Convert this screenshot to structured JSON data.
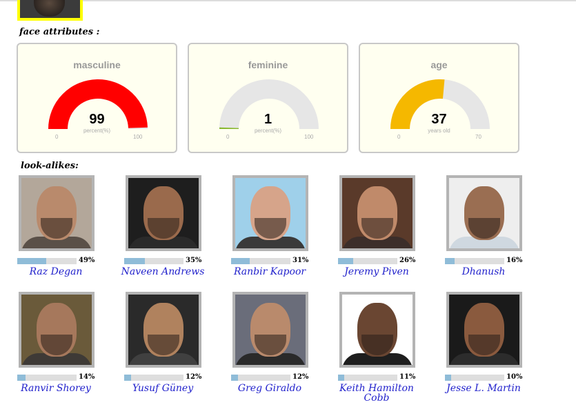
{
  "face_attributes_title": "face attributes :",
  "look_alikes_title": "look-alikes:",
  "gauges": [
    {
      "title": "masculine",
      "value": 99,
      "display": "99",
      "unit": "percent(%)",
      "min": "0",
      "max": "100",
      "color": "#ff0000"
    },
    {
      "title": "feminine",
      "value": 1,
      "display": "1",
      "unit": "percent(%)",
      "min": "0",
      "max": "100",
      "color": "#88b830"
    },
    {
      "title": "age",
      "value": 37,
      "display": "37",
      "unit": "years old",
      "min": "0",
      "max": "70",
      "color": "#f5b800"
    }
  ],
  "gauge_track_color": "#e6e6e6",
  "lookalikes": [
    {
      "name": "Raz Degan",
      "pct": "49%",
      "score": 0.49
    },
    {
      "name": "Naveen Andrews",
      "pct": "35%",
      "score": 0.35
    },
    {
      "name": "Ranbir Kapoor",
      "pct": "31%",
      "score": 0.31
    },
    {
      "name": "Jeremy Piven",
      "pct": "26%",
      "score": 0.26
    },
    {
      "name": "Dhanush",
      "pct": "16%",
      "score": 0.16
    },
    {
      "name": "Ranvir Shorey",
      "pct": "14%",
      "score": 0.14
    },
    {
      "name": "Yusuf Güney",
      "pct": "12%",
      "score": 0.12
    },
    {
      "name": "Greg Giraldo",
      "pct": "12%",
      "score": 0.12
    },
    {
      "name": "Keith Hamilton Cobb",
      "pct": "11%",
      "score": 0.11
    },
    {
      "name": "Jesse L. Martin",
      "pct": "10%",
      "score": 0.1
    }
  ]
}
